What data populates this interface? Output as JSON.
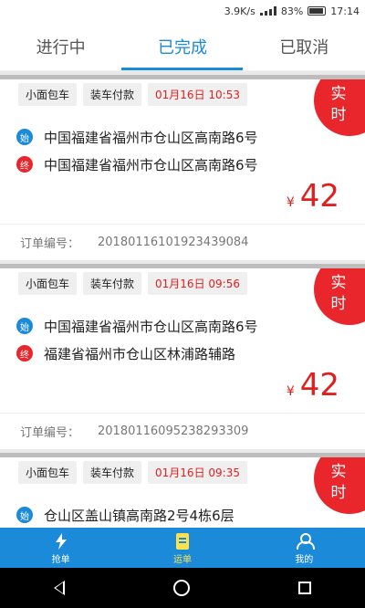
{
  "status_bar": {
    "network_speed": "3.9K/s",
    "battery": "83%",
    "time": "17:14"
  },
  "tabs": [
    {
      "label": "进行中"
    },
    {
      "label": "已完成"
    },
    {
      "label": "已取消"
    }
  ],
  "orders": [
    {
      "vehicle": "小面包车",
      "payment": "装车付款",
      "time": "01月16日 10:53",
      "badge": [
        "实",
        "时"
      ],
      "start_marker": "始",
      "start": "中国福建省福州市仓山区高南路6号",
      "end_marker": "终",
      "end": "中国福建省福州市仓山区高南路6号",
      "currency": "¥",
      "price": "42",
      "order_label": "订单编号：",
      "order_no": "20180116101923439084"
    },
    {
      "vehicle": "小面包车",
      "payment": "装车付款",
      "time": "01月16日 09:56",
      "badge": [
        "实",
        "时"
      ],
      "start_marker": "始",
      "start": "中国福建省福州市仓山区高南路6号",
      "end_marker": "终",
      "end": "福建省福州市仓山区林浦路辅路",
      "currency": "¥",
      "price": "42",
      "order_label": "订单编号：",
      "order_no": "20180116095238293309"
    },
    {
      "vehicle": "小面包车",
      "payment": "装车付款",
      "time": "01月16日 09:35",
      "badge": [
        "实",
        "时"
      ],
      "start_marker": "始",
      "start": "仓山区盖山镇高南路2号4栋6层"
    }
  ],
  "bottom_nav": [
    {
      "label": "抢单",
      "icon": "lightning-icon"
    },
    {
      "label": "运单",
      "icon": "document-icon"
    },
    {
      "label": "我的",
      "icon": "user-icon"
    }
  ],
  "colors": {
    "accent": "#1a8ad9",
    "danger": "#e8262b",
    "active_nav": "#ffe14d"
  }
}
